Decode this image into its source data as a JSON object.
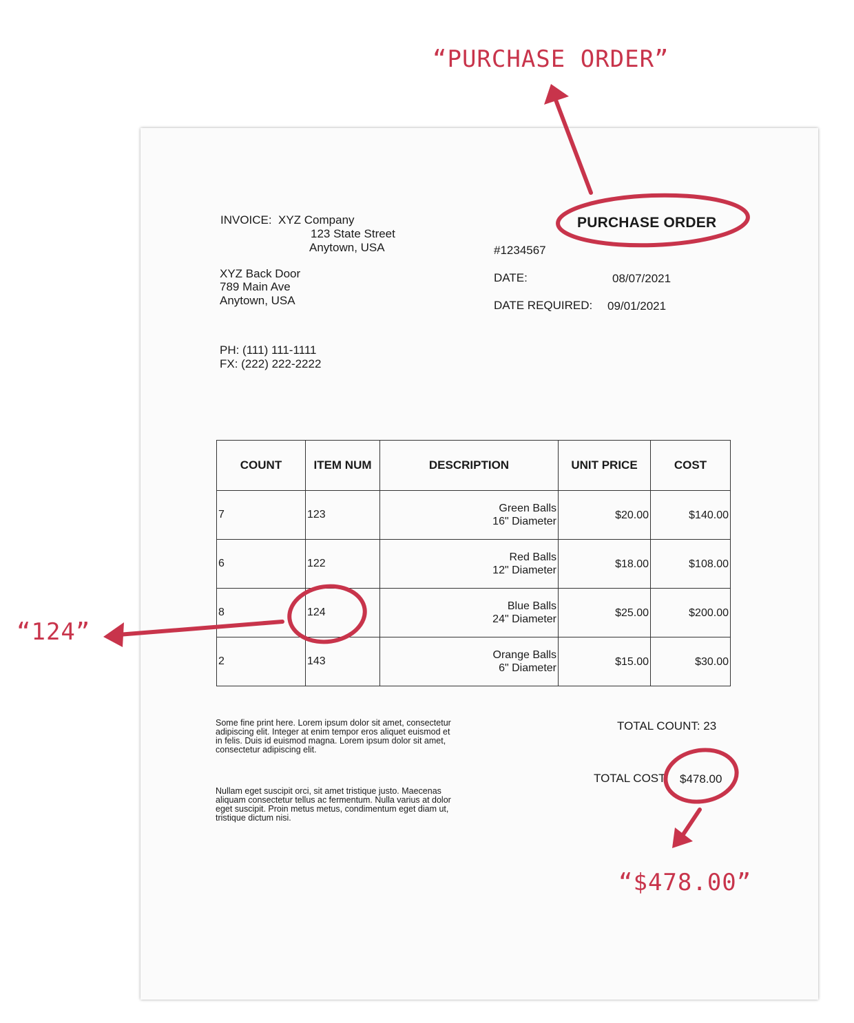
{
  "document": {
    "invoice_label": "INVOICE:",
    "company_name": "XYZ Company",
    "company_street": "123 State Street",
    "company_city": "Anytown, USA",
    "title": "PURCHASE ORDER",
    "po_number": "#1234567",
    "date_label": "DATE:",
    "date_value": "08/07/2021",
    "date_required_label": "DATE REQUIRED:",
    "date_required_value": "09/01/2021",
    "ship_name": "XYZ Back Door",
    "ship_street": "789 Main Ave",
    "ship_city": "Anytown, USA",
    "phone": "PH: (111) 111-1111",
    "fax": "FX: (222) 222-2222",
    "table": {
      "headers": [
        "COUNT",
        "ITEM NUM",
        "DESCRIPTION",
        "UNIT PRICE",
        "COST"
      ],
      "rows": [
        {
          "count": "7",
          "item_num": "123",
          "desc_line1": "Green Balls",
          "desc_line2": "16\" Diameter",
          "unit_price": "$20.00",
          "cost": "$140.00"
        },
        {
          "count": "6",
          "item_num": "122",
          "desc_line1": "Red Balls",
          "desc_line2": "12\" Diameter",
          "unit_price": "$18.00",
          "cost": "$108.00"
        },
        {
          "count": "8",
          "item_num": "124",
          "desc_line1": "Blue Balls",
          "desc_line2": "24\" Diameter",
          "unit_price": "$25.00",
          "cost": "$200.00"
        },
        {
          "count": "2",
          "item_num": "143",
          "desc_line1": "Orange Balls",
          "desc_line2": "6\" Diameter",
          "unit_price": "$15.00",
          "cost": "$30.00"
        }
      ]
    },
    "fine_print_1": "Some fine print here. Lorem ipsum dolor sit amet, consectetur adipiscing elit. Integer at enim tempor eros aliquet euismod et in felis. Duis id euismod magna. Lorem ipsum dolor sit amet, consectetur adipiscing elit.",
    "fine_print_2": "Nullam eget suscipit orci, sit amet tristique justo. Maecenas aliquam consectetur tellus ac fermentum. Nulla varius at dolor eget suscipit. Proin metus metus, condimentum eget diam ut, tristique dictum nisi.",
    "total_count": "TOTAL COUNT: 23",
    "total_cost_label": "TOTAL COST:",
    "total_cost_value": "$478.00"
  },
  "annotations": {
    "title_callout": "“PURCHASE ORDER”",
    "item_callout": "“124”",
    "total_callout": "“$478.00”",
    "color": "#c8344b"
  }
}
